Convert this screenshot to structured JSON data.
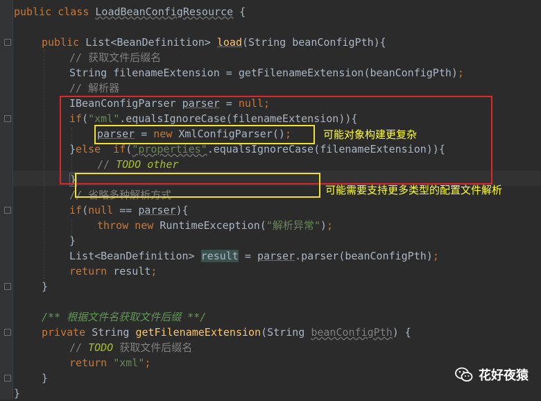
{
  "code": {
    "l1": {
      "k1": "public class ",
      "name": "LoadBeanConfigResource",
      "rest": " {"
    },
    "l3": {
      "k1": "public ",
      "t1": "List<BeanDefinition> ",
      "fn": "load",
      "p1": "(String beanConfigPth){"
    },
    "l4": {
      "c": "// 获取文件后缀名"
    },
    "l5": {
      "t1": "String filenameExtension = getFilenameExtension(beanConfigPth)",
      "semi": ";"
    },
    "l6": {
      "c": "// 解析器"
    },
    "l7": {
      "t1": "IBeanConfigParser ",
      "v": "parser",
      "t2": " = ",
      "k": "null",
      "semi": ";"
    },
    "l8": {
      "k": "if",
      "p1": "(",
      "s": "\"xml\"",
      "p2": ".equalsIgnoreCase(filenameExtension)){"
    },
    "l9": {
      "v": "parser",
      "t1": " = ",
      "k": "new ",
      "t2": "XmlConfigParser()",
      "semi": ";"
    },
    "l10": {
      "p1": "}",
      "k1": "else  ",
      "k2": "if",
      "p2": "(",
      "s": "\"properties\"",
      "p3": ".equalsIgnoreCase(filenameExtension)){"
    },
    "l11": {
      "c": "// ",
      "todo": "TODO other"
    },
    "l12": {
      "b": "}"
    },
    "l13": {
      "c": "// 省略多种解析方式"
    },
    "l14": {
      "k": "if",
      "p1": "(",
      "k2": "null",
      "p2": " == ",
      "v": "parser",
      "p3": "){"
    },
    "l15": {
      "k1": "throw new ",
      "t1": "RuntimeException(",
      "s": "\"解析异常\"",
      "p1": ")",
      "semi": ";"
    },
    "l16": {
      "b": "}"
    },
    "l17": {
      "t1": "List<BeanDefinition> ",
      "v": "result",
      "t2": " = ",
      "v2": "parser",
      "t3": ".parser(beanConfigPth)",
      "semi": ";"
    },
    "l18": {
      "k": "return ",
      "t1": "result",
      "semi": ";"
    },
    "l19": {
      "b": "}"
    },
    "l21": {
      "d": "/** 根据文件名获取文件后缀 **/"
    },
    "l22": {
      "k1": "private ",
      "t1": "String ",
      "fn": "getFilenameExtension",
      "p1": "(String ",
      "unused": "beanConfigPth",
      "p2": ") {"
    },
    "l23": {
      "c": "// ",
      "todo": "TODO",
      "c2": " 获取文件后缀名"
    },
    "l24": {
      "k": "return ",
      "s": "\"xml\"",
      "semi": ";"
    },
    "l25": {
      "b": "}"
    },
    "l26": {
      "b": "}"
    }
  },
  "annotations": {
    "note1": "可能对象构建更复杂",
    "note2": "可能需要支持更多类型的配置文件解析"
  },
  "watermark": {
    "icon": "wechat-icon",
    "text": "花好夜猿"
  },
  "colors": {
    "background": "#2b2b2b",
    "keyword": "#cc7832",
    "string": "#6a8759",
    "comment": "#808080",
    "function": "#ffc66d",
    "red_box": "#e0262c",
    "yellow_box": "#f2e22c",
    "note_text": "#ffff33"
  }
}
